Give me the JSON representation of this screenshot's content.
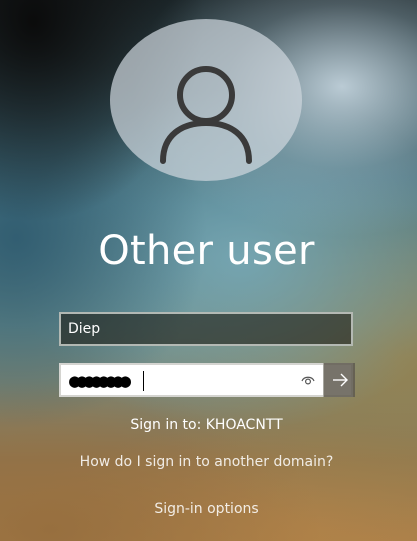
{
  "user": {
    "display_name": "Other user",
    "avatar_icon": "user-silhouette-icon"
  },
  "username_field": {
    "value": "Diep"
  },
  "password_field": {
    "masked_value": "●●●●●●●●",
    "reveal_icon": "eye-icon",
    "submit_icon": "arrow-right-icon"
  },
  "sign_in_to": "Sign in to: KHOACNTT",
  "links": {
    "other_domain": "How do I sign in to another domain?",
    "sign_in_options": "Sign-in options"
  },
  "colors": {
    "text": "#ffffff",
    "password_bg": "#ffffff",
    "submit_bg": "#5f5a50"
  }
}
